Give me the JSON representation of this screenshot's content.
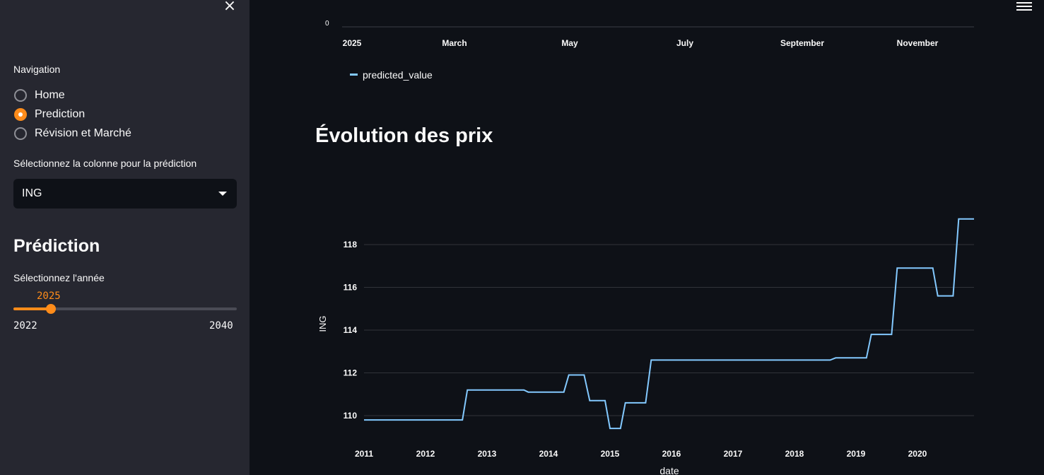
{
  "sidebar": {
    "close_icon": "×",
    "navigation_label": "Navigation",
    "nav_items": [
      {
        "label": "Home",
        "selected": false
      },
      {
        "label": "Prediction",
        "selected": true
      },
      {
        "label": "Révision et Marché",
        "selected": false
      }
    ],
    "column_select_label": "Sélectionnez la colonne pour la prédiction",
    "column_select_value": "ING",
    "prediction_heading": "Prédiction",
    "year_label": "Sélectionnez l'année",
    "year_slider": {
      "value": 2025,
      "value_text": "2025",
      "min": 2022,
      "min_text": "2022",
      "max": 2040,
      "max_text": "2040"
    }
  },
  "colors": {
    "accent": "#ff8c1a",
    "line": "#83c9ff",
    "background": "#0e1117",
    "sidebar": "#262730"
  },
  "main": {
    "section_title": "Évolution des prix"
  },
  "chart_data": [
    {
      "type": "line",
      "partial": true,
      "x_tick_labels": [
        "2025",
        "March",
        "May",
        "July",
        "September",
        "November"
      ],
      "y_tick_labels": [
        "0"
      ],
      "legend": [
        "predicted_value"
      ],
      "series": [
        {
          "name": "predicted_value",
          "color": "#83c9ff",
          "values": []
        }
      ]
    },
    {
      "type": "line",
      "title": "Évolution des prix",
      "xlabel": "date",
      "ylabel": "ING",
      "xlim": [
        2011.0,
        2020.92
      ],
      "ylim": [
        109,
        119.6
      ],
      "x_ticks": [
        2011,
        2012,
        2013,
        2014,
        2015,
        2016,
        2017,
        2018,
        2019,
        2020
      ],
      "y_ticks": [
        110,
        112,
        114,
        116,
        118
      ],
      "grid": true,
      "series": [
        {
          "name": "ING",
          "color": "#83c9ff",
          "x": [
            2011.0,
            2012.6,
            2012.68,
            2013.6,
            2013.67,
            2014.25,
            2014.33,
            2014.58,
            2014.67,
            2014.92,
            2015.0,
            2015.17,
            2015.25,
            2015.58,
            2015.67,
            2018.58,
            2018.67,
            2019.17,
            2019.25,
            2019.58,
            2019.67,
            2020.25,
            2020.33,
            2020.58,
            2020.67,
            2020.92
          ],
          "y": [
            109.8,
            109.8,
            111.2,
            111.2,
            111.1,
            111.1,
            111.9,
            111.9,
            110.7,
            110.7,
            109.4,
            109.4,
            110.6,
            110.6,
            112.6,
            112.6,
            112.7,
            112.7,
            113.8,
            113.8,
            116.9,
            116.9,
            115.6,
            115.6,
            119.2,
            119.2
          ]
        }
      ]
    }
  ]
}
